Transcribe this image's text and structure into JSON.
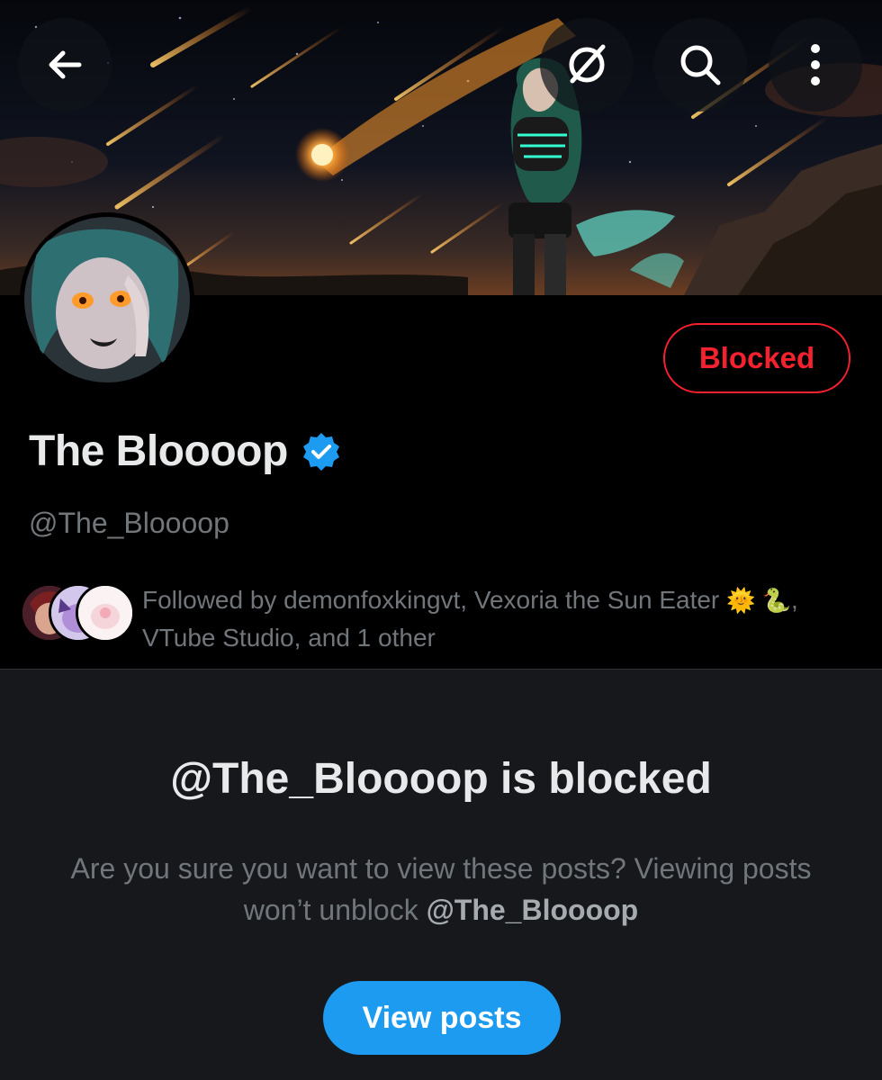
{
  "header": {
    "back_icon": "arrow-left-icon",
    "grok_icon": "slash-circle-icon",
    "search_icon": "search-icon",
    "more_icon": "more-vertical-icon"
  },
  "profile": {
    "display_name": "The Bloooop",
    "verified": true,
    "handle": "@The_Bloooop",
    "status_button": "Blocked",
    "followed_by_line1": "Followed by demonfoxkingvt, Vexoria the Sun Eater",
    "followed_by_emoji": "🌞 🐍",
    "followed_by_sep": ",",
    "followed_by_line2": "VTube Studio, and 1 other"
  },
  "blocked_notice": {
    "title": "@The_Bloooop is blocked",
    "description": "Are you sure you want to view these posts? Viewing posts won’t unblock",
    "description_handle": "@The_Bloooop",
    "button": "View posts"
  },
  "colors": {
    "accent": "#1d9bf0",
    "danger": "#f4212e",
    "muted_text": "#71767b",
    "panel_bg": "#16181c"
  }
}
